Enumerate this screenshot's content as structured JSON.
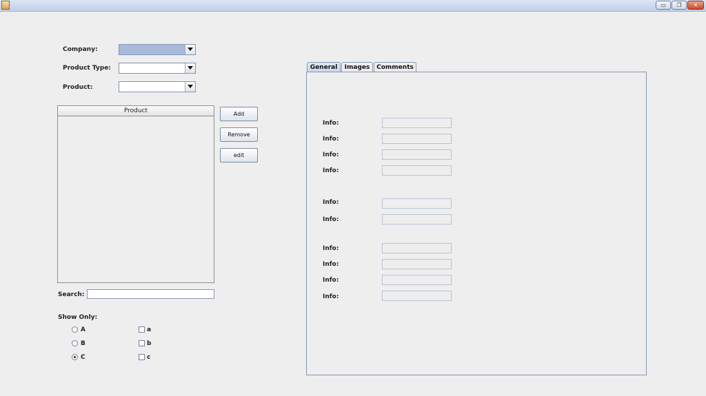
{
  "window": {
    "minimize_glyph": "▭",
    "maximize_glyph": "❐",
    "close_glyph": "✕"
  },
  "filters": {
    "company_label": "Company:",
    "product_type_label": "Product Type:",
    "product_label": "Product:"
  },
  "product_list": {
    "header": "Product"
  },
  "actions": {
    "add": "Add",
    "remove": "Remove",
    "edit": "edit"
  },
  "search": {
    "label": "Search:",
    "value": ""
  },
  "show_only": {
    "label": "Show Only:",
    "radios": [
      {
        "label": "A",
        "checked": false
      },
      {
        "label": "B",
        "checked": false
      },
      {
        "label": "C",
        "checked": true
      }
    ],
    "checkboxes": [
      {
        "label": "a",
        "checked": false
      },
      {
        "label": "b",
        "checked": false
      },
      {
        "label": "c",
        "checked": false
      }
    ]
  },
  "tabs": [
    {
      "label": "General",
      "active": true
    },
    {
      "label": "Images",
      "active": false
    },
    {
      "label": "Comments",
      "active": false
    }
  ],
  "general_fields": [
    {
      "label": "Info:",
      "value": ""
    },
    {
      "label": "Info:",
      "value": ""
    },
    {
      "label": "Info:",
      "value": ""
    },
    {
      "label": "Info:",
      "value": ""
    },
    {
      "label": "Info:",
      "value": ""
    },
    {
      "label": "Info:",
      "value": ""
    },
    {
      "label": "Info:",
      "value": ""
    },
    {
      "label": "Info:",
      "value": ""
    },
    {
      "label": "Info:",
      "value": ""
    },
    {
      "label": "Info:",
      "value": ""
    }
  ]
}
